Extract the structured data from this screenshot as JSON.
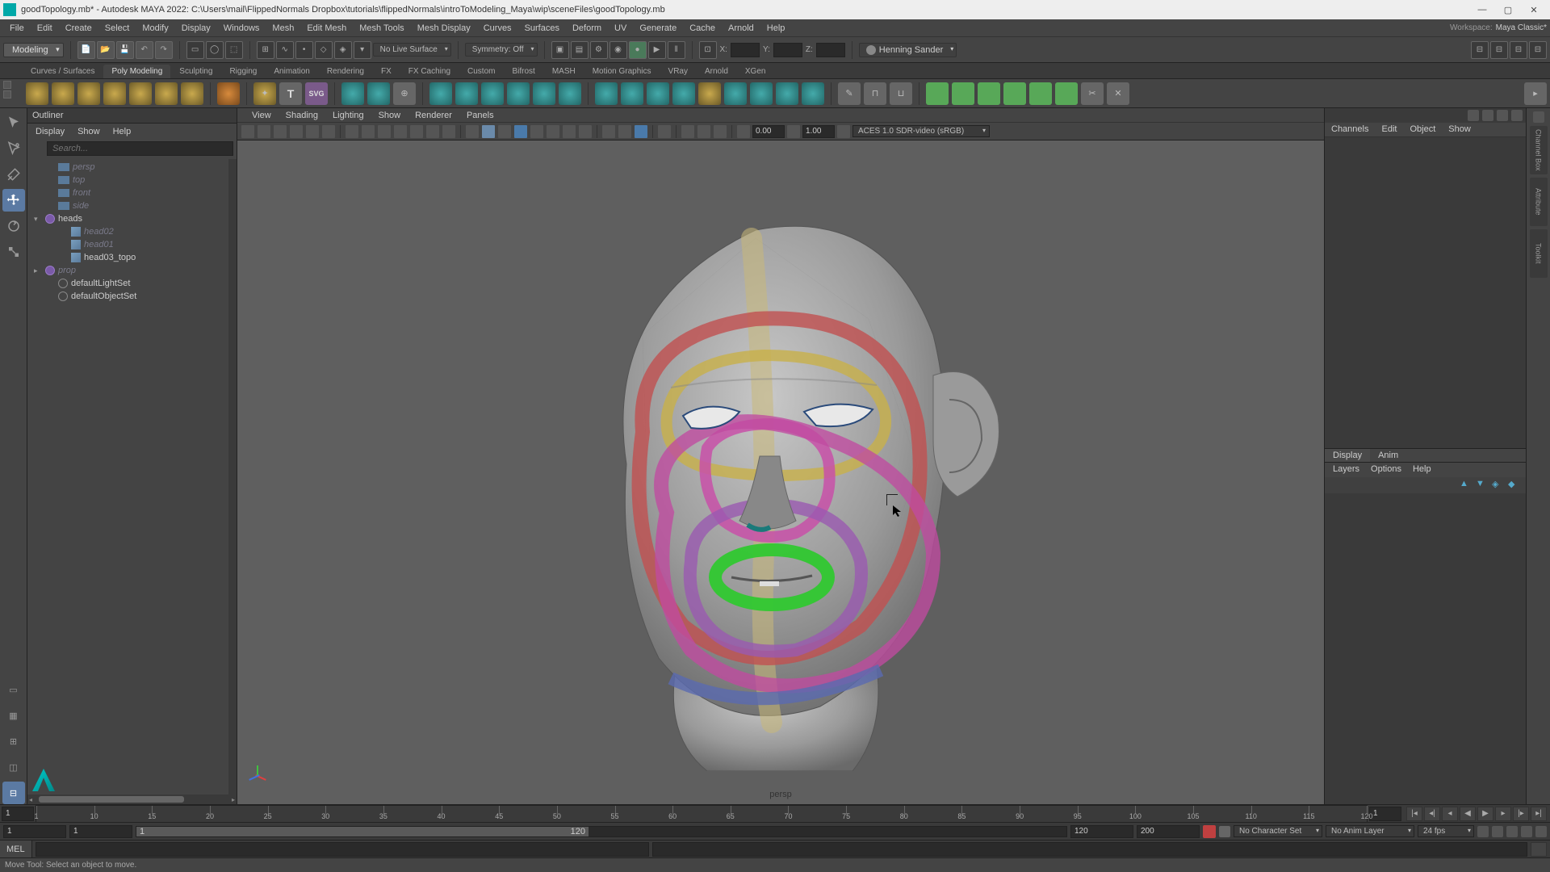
{
  "titlebar": {
    "title": "goodTopology.mb* - Autodesk MAYA 2022: C:\\Users\\mail\\FlippedNormals Dropbox\\tutorials\\flippedNormals\\introToModeling_Maya\\wip\\sceneFiles\\goodTopology.mb"
  },
  "menubar": {
    "items": [
      "File",
      "Edit",
      "Create",
      "Select",
      "Modify",
      "Display",
      "Windows",
      "Mesh",
      "Edit Mesh",
      "Mesh Tools",
      "Mesh Display",
      "Curves",
      "Surfaces",
      "Deform",
      "UV",
      "Generate",
      "Cache",
      "Arnold",
      "Help"
    ],
    "workspace_label": "Workspace:",
    "workspace_value": "Maya Classic*"
  },
  "status": {
    "module": "Modeling",
    "live_surface": "No Live Surface",
    "symmetry": "Symmetry: Off",
    "coord": {
      "x": "X:",
      "y": "Y:",
      "z": "Z:"
    },
    "account": "Henning Sander"
  },
  "shelf_tabs": [
    "Curves / Surfaces",
    "Poly Modeling",
    "Sculpting",
    "Rigging",
    "Animation",
    "Rendering",
    "FX",
    "FX Caching",
    "Custom",
    "Bifrost",
    "MASH",
    "Motion Graphics",
    "VRay",
    "Arnold",
    "XGen"
  ],
  "shelf_active": "Poly Modeling",
  "outliner": {
    "title": "Outliner",
    "menu": [
      "Display",
      "Show",
      "Help"
    ],
    "search_placeholder": "Search...",
    "items": {
      "persp": "persp",
      "top": "top",
      "front": "front",
      "side": "side",
      "heads": "heads",
      "head02": "head02",
      "head01": "head01",
      "head03_topo": "head03_topo",
      "prop": "prop",
      "defaultLightSet": "defaultLightSet",
      "defaultObjectSet": "defaultObjectSet"
    }
  },
  "viewport": {
    "menus": [
      "View",
      "Shading",
      "Lighting",
      "Show",
      "Renderer",
      "Panels"
    ],
    "exposure": "0.00",
    "gamma": "1.00",
    "colorspace": "ACES 1.0 SDR-video (sRGB)",
    "camera": "persp"
  },
  "channelbox": {
    "tabs": [
      "Channels",
      "Edit",
      "Object",
      "Show"
    ]
  },
  "layers": {
    "tabs": [
      "Display",
      "Anim"
    ],
    "menu": [
      "Layers",
      "Options",
      "Help"
    ]
  },
  "timeline": {
    "ticks": [
      "1",
      "10",
      "15",
      "20",
      "25",
      "30",
      "35",
      "40",
      "45",
      "50",
      "55",
      "60",
      "65",
      "70",
      "75",
      "80",
      "85",
      "90",
      "95",
      "100",
      "105",
      "110",
      "115",
      "120"
    ],
    "current": "1"
  },
  "range": {
    "start_outer": "1",
    "start_inner": "1",
    "thumb_start": "1",
    "thumb_end": "120",
    "end_inner": "120",
    "end_outer": "200",
    "char_set": "No Character Set",
    "anim_layer": "No Anim Layer",
    "fps": "24 fps"
  },
  "cmd": {
    "label": "MEL"
  },
  "help": {
    "msg": "Move Tool: Select an object to move."
  }
}
